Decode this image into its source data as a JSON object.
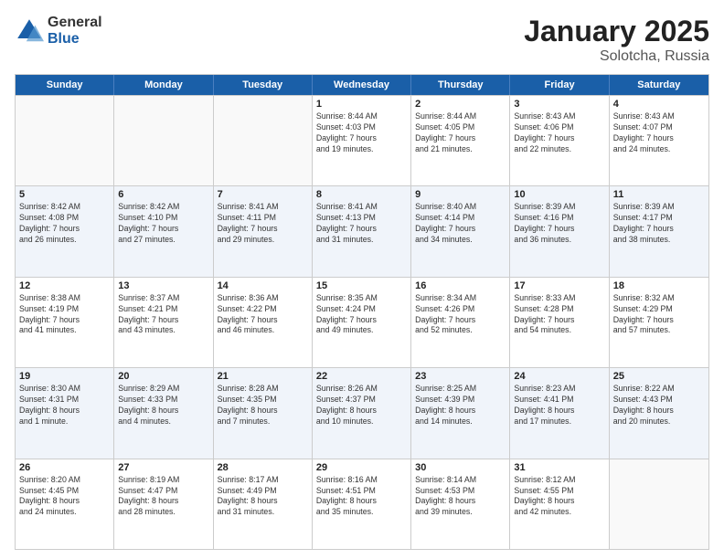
{
  "logo": {
    "general": "General",
    "blue": "Blue"
  },
  "title": "January 2025",
  "subtitle": "Solotcha, Russia",
  "header_days": [
    "Sunday",
    "Monday",
    "Tuesday",
    "Wednesday",
    "Thursday",
    "Friday",
    "Saturday"
  ],
  "rows": [
    [
      {
        "day": "",
        "text": "",
        "empty": true
      },
      {
        "day": "",
        "text": "",
        "empty": true
      },
      {
        "day": "",
        "text": "",
        "empty": true
      },
      {
        "day": "1",
        "text": "Sunrise: 8:44 AM\nSunset: 4:03 PM\nDaylight: 7 hours\nand 19 minutes.",
        "empty": false
      },
      {
        "day": "2",
        "text": "Sunrise: 8:44 AM\nSunset: 4:05 PM\nDaylight: 7 hours\nand 21 minutes.",
        "empty": false
      },
      {
        "day": "3",
        "text": "Sunrise: 8:43 AM\nSunset: 4:06 PM\nDaylight: 7 hours\nand 22 minutes.",
        "empty": false
      },
      {
        "day": "4",
        "text": "Sunrise: 8:43 AM\nSunset: 4:07 PM\nDaylight: 7 hours\nand 24 minutes.",
        "empty": false
      }
    ],
    [
      {
        "day": "5",
        "text": "Sunrise: 8:42 AM\nSunset: 4:08 PM\nDaylight: 7 hours\nand 26 minutes.",
        "empty": false
      },
      {
        "day": "6",
        "text": "Sunrise: 8:42 AM\nSunset: 4:10 PM\nDaylight: 7 hours\nand 27 minutes.",
        "empty": false
      },
      {
        "day": "7",
        "text": "Sunrise: 8:41 AM\nSunset: 4:11 PM\nDaylight: 7 hours\nand 29 minutes.",
        "empty": false
      },
      {
        "day": "8",
        "text": "Sunrise: 8:41 AM\nSunset: 4:13 PM\nDaylight: 7 hours\nand 31 minutes.",
        "empty": false
      },
      {
        "day": "9",
        "text": "Sunrise: 8:40 AM\nSunset: 4:14 PM\nDaylight: 7 hours\nand 34 minutes.",
        "empty": false
      },
      {
        "day": "10",
        "text": "Sunrise: 8:39 AM\nSunset: 4:16 PM\nDaylight: 7 hours\nand 36 minutes.",
        "empty": false
      },
      {
        "day": "11",
        "text": "Sunrise: 8:39 AM\nSunset: 4:17 PM\nDaylight: 7 hours\nand 38 minutes.",
        "empty": false
      }
    ],
    [
      {
        "day": "12",
        "text": "Sunrise: 8:38 AM\nSunset: 4:19 PM\nDaylight: 7 hours\nand 41 minutes.",
        "empty": false
      },
      {
        "day": "13",
        "text": "Sunrise: 8:37 AM\nSunset: 4:21 PM\nDaylight: 7 hours\nand 43 minutes.",
        "empty": false
      },
      {
        "day": "14",
        "text": "Sunrise: 8:36 AM\nSunset: 4:22 PM\nDaylight: 7 hours\nand 46 minutes.",
        "empty": false
      },
      {
        "day": "15",
        "text": "Sunrise: 8:35 AM\nSunset: 4:24 PM\nDaylight: 7 hours\nand 49 minutes.",
        "empty": false
      },
      {
        "day": "16",
        "text": "Sunrise: 8:34 AM\nSunset: 4:26 PM\nDaylight: 7 hours\nand 52 minutes.",
        "empty": false
      },
      {
        "day": "17",
        "text": "Sunrise: 8:33 AM\nSunset: 4:28 PM\nDaylight: 7 hours\nand 54 minutes.",
        "empty": false
      },
      {
        "day": "18",
        "text": "Sunrise: 8:32 AM\nSunset: 4:29 PM\nDaylight: 7 hours\nand 57 minutes.",
        "empty": false
      }
    ],
    [
      {
        "day": "19",
        "text": "Sunrise: 8:30 AM\nSunset: 4:31 PM\nDaylight: 8 hours\nand 1 minute.",
        "empty": false
      },
      {
        "day": "20",
        "text": "Sunrise: 8:29 AM\nSunset: 4:33 PM\nDaylight: 8 hours\nand 4 minutes.",
        "empty": false
      },
      {
        "day": "21",
        "text": "Sunrise: 8:28 AM\nSunset: 4:35 PM\nDaylight: 8 hours\nand 7 minutes.",
        "empty": false
      },
      {
        "day": "22",
        "text": "Sunrise: 8:26 AM\nSunset: 4:37 PM\nDaylight: 8 hours\nand 10 minutes.",
        "empty": false
      },
      {
        "day": "23",
        "text": "Sunrise: 8:25 AM\nSunset: 4:39 PM\nDaylight: 8 hours\nand 14 minutes.",
        "empty": false
      },
      {
        "day": "24",
        "text": "Sunrise: 8:23 AM\nSunset: 4:41 PM\nDaylight: 8 hours\nand 17 minutes.",
        "empty": false
      },
      {
        "day": "25",
        "text": "Sunrise: 8:22 AM\nSunset: 4:43 PM\nDaylight: 8 hours\nand 20 minutes.",
        "empty": false
      }
    ],
    [
      {
        "day": "26",
        "text": "Sunrise: 8:20 AM\nSunset: 4:45 PM\nDaylight: 8 hours\nand 24 minutes.",
        "empty": false
      },
      {
        "day": "27",
        "text": "Sunrise: 8:19 AM\nSunset: 4:47 PM\nDaylight: 8 hours\nand 28 minutes.",
        "empty": false
      },
      {
        "day": "28",
        "text": "Sunrise: 8:17 AM\nSunset: 4:49 PM\nDaylight: 8 hours\nand 31 minutes.",
        "empty": false
      },
      {
        "day": "29",
        "text": "Sunrise: 8:16 AM\nSunset: 4:51 PM\nDaylight: 8 hours\nand 35 minutes.",
        "empty": false
      },
      {
        "day": "30",
        "text": "Sunrise: 8:14 AM\nSunset: 4:53 PM\nDaylight: 8 hours\nand 39 minutes.",
        "empty": false
      },
      {
        "day": "31",
        "text": "Sunrise: 8:12 AM\nSunset: 4:55 PM\nDaylight: 8 hours\nand 42 minutes.",
        "empty": false
      },
      {
        "day": "",
        "text": "",
        "empty": true
      }
    ]
  ]
}
